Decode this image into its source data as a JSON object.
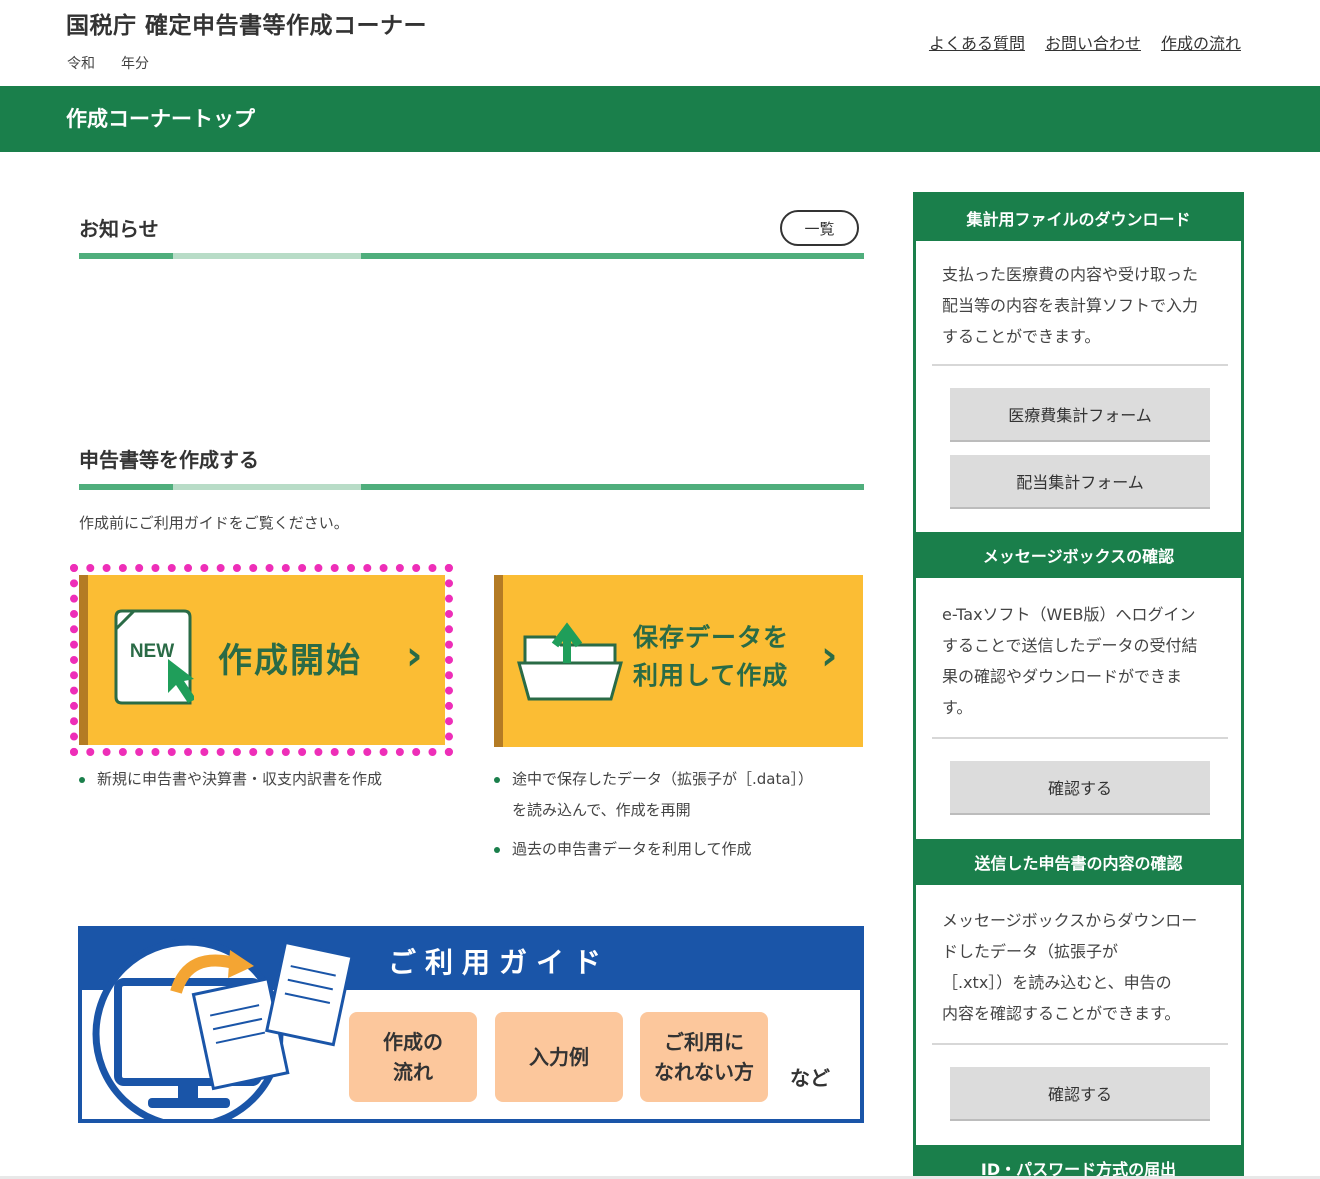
{
  "header": {
    "title": "国税庁 確定申告書等作成コーナー",
    "era": "令和",
    "year_suffix": "年分",
    "links": [
      "よくある質問",
      "お問い合わせ",
      "作成の流れ"
    ]
  },
  "topbar": {
    "title": "作成コーナートップ"
  },
  "news": {
    "title": "お知らせ",
    "list_button": "一覧"
  },
  "create": {
    "title": "申告書等を作成する",
    "note": "作成前にご利用ガイドをご覧ください。",
    "start": {
      "icon_text": "NEW",
      "label": "作成開始",
      "bullets": [
        "新規に申告書や決算書・収支内訳書を作成"
      ]
    },
    "saved": {
      "label_line1": "保存データを",
      "label_line2": "利用して作成",
      "bullets": [
        "途中で保存したデータ（拡張子が［.data］）",
        "を読み込んで、作成を再開",
        "過去の申告書データを利用して作成"
      ]
    }
  },
  "guide": {
    "title": "ご利用ガイド",
    "pills": [
      {
        "line1": "作成の",
        "line2": "流れ"
      },
      {
        "line1": "入力例",
        "line2": ""
      },
      {
        "line1": "ご利用に",
        "line2": "なれない方"
      }
    ],
    "etc": "など"
  },
  "sidebar": {
    "sections": [
      {
        "title": "集計用ファイルのダウンロード",
        "text": [
          "支払った医療費の内容や受け取った",
          "配当等の内容を表計算ソフトで入力",
          "することができます。"
        ],
        "buttons": [
          "医療費集計フォーム",
          "配当集計フォーム"
        ]
      },
      {
        "title": "メッセージボックスの確認",
        "text": [
          "e-Taxソフト（WEB版）へログイン",
          "することで送信したデータの受付結",
          "果の確認やダウンロードができま",
          "す。"
        ],
        "buttons": [
          "確認する"
        ]
      },
      {
        "title": "送信した申告書の内容の確認",
        "text": [
          "メッセージボックスからダウンロー",
          "ドしたデータ（拡張子が",
          "［.xtx］）を読み込むと、申告の",
          "内容を確認することができます。"
        ],
        "buttons": [
          "確認する"
        ]
      },
      {
        "title": "ID・パスワード方式の届出",
        "text": [],
        "buttons": []
      }
    ]
  },
  "colors": {
    "brand_green": "#1a7f4b",
    "button_yellow": "#fbbd34",
    "guide_blue": "#1a55a8",
    "highlight_magenta": "#ee2eb8"
  }
}
